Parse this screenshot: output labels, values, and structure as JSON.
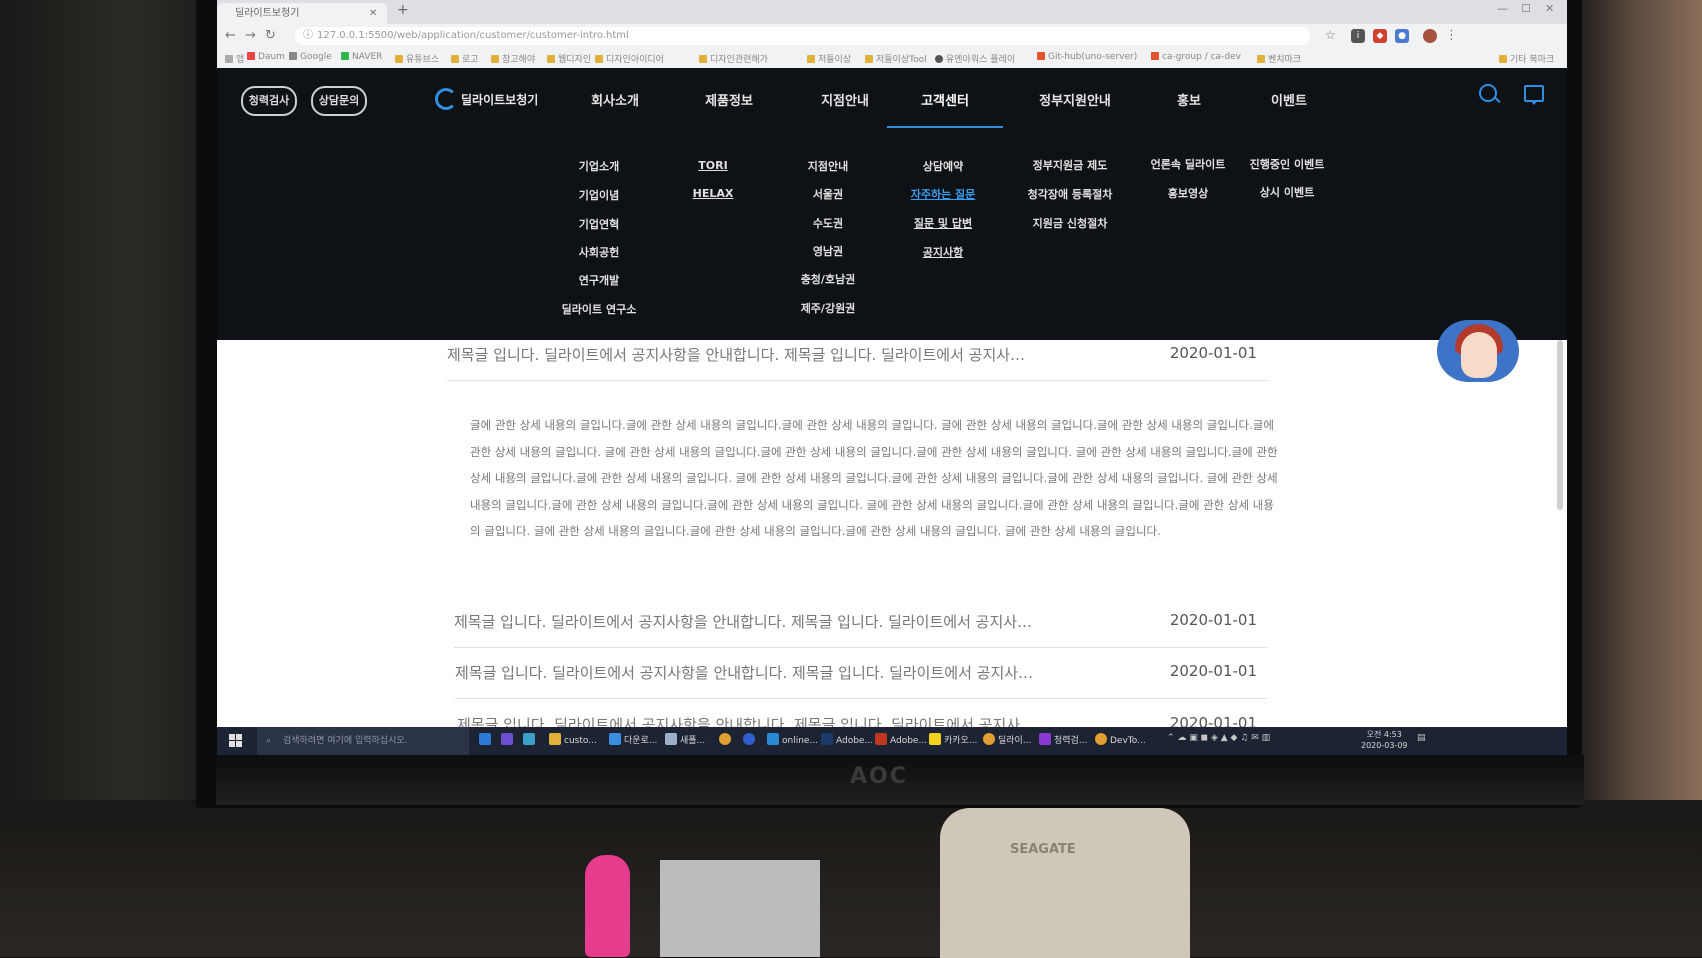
{
  "browser": {
    "tab_title": "딜라이트보청기",
    "url": "127.0.0.1:5500/web/application/customer/customer-intro.html",
    "bookmarks": [
      "앱",
      "Daum",
      "Google",
      "NAVER",
      "유튜브스",
      "로고",
      "참고해야",
      "웹디자인",
      "디자인아이디어",
      "디자인관련해가",
      "저들이상",
      "저들이상Tool",
      "유엔아워스 플레이",
      "Git-hub(uno-server)",
      "ca-group / ca-dev",
      "벤치마크"
    ],
    "other_bookmarks": "기타 북마크"
  },
  "site": {
    "buttons": [
      "청력검사",
      "상담문의"
    ],
    "logo_text": "딜라이트보청기",
    "menu": [
      "회사소개",
      "제품정보",
      "지점안내",
      "고객센터",
      "정부지원안내",
      "홍보",
      "이벤트"
    ],
    "active_menu": "고객센터",
    "submenu": {
      "company": [
        "기업소개",
        "기업이념",
        "기업연혁",
        "사회공헌",
        "연구개발",
        "딜라이트 연구소"
      ],
      "product": [
        "TORI",
        "HELAX"
      ],
      "branch": [
        "지점안내",
        "서울권",
        "수도권",
        "영남권",
        "충청/호남권",
        "제주/강원권"
      ],
      "support": [
        "상담예약",
        "자주하는 질문",
        "질문 및 답변",
        "공지사항"
      ],
      "gov": [
        "정부지원금 제도",
        "청각장애 등록절차",
        "지원금 신청절차"
      ],
      "pr": [
        "언론속 딜라이트",
        "홍보영상"
      ],
      "event": [
        "진행중인 이벤트",
        "상시 이벤트"
      ]
    }
  },
  "notice": {
    "rows": [
      {
        "title": "제목글 입니다. 딜라이트에서 공지사항을 안내합니다. 제목글 입니다. 딜라이트에서 공지사…",
        "date": "2020-01-01"
      },
      {
        "title": "제목글 입니다. 딜라이트에서 공지사항을 안내합니다. 제목글 입니다. 딜라이트에서 공지사…",
        "date": "2020-01-01"
      },
      {
        "title": "제목글 입니다. 딜라이트에서 공지사항을 안내합니다. 제목글 입니다. 딜라이트에서 공지사…",
        "date": "2020-01-01"
      },
      {
        "title": "제목글 입니다. 딜라이트에서 공지사항을 안내합니다. 제목글 입니다. 딜라이트에서 공지사…",
        "date": "2020-01-01"
      }
    ],
    "detail": "글에 관한 상세 내용의 글입니다.글에 관한 상세 내용의 글입니다.글에 관한 상세 내용의 글입니다. 글에 관한 상세 내용의 글입니다.글에 관한 상세 내용의 글입니다.글에 관한 상세 내용의 글입니다. 글에 관한 상세 내용의 글입니다.글에 관한 상세 내용의 글입니다.글에 관한 상세 내용의 글입니다. 글에 관한 상세 내용의 글입니다.글에 관한 상세 내용의 글입니다.글에 관한 상세 내용의 글입니다. 글에 관한 상세 내용의 글입니다.글에 관한 상세 내용의 글입니다.글에 관한 상세 내용의 글입니다. 글에 관한 상세 내용의 글입니다.글에 관한 상세 내용의 글입니다.글에 관한 상세 내용의 글입니다. 글에 관한 상세 내용의 글입니다.글에 관한 상세 내용의 글입니다.글에 관한 상세 내용의 글입니다. 글에 관한 상세 내용의 글입니다.글에 관한 상세 내용의 글입니다.글에 관한 상세 내용의 글입니다. 글에 관한 상세 내용의 글입니다."
  },
  "taskbar": {
    "search_placeholder": "검색하려면 여기에 입력하십시오.",
    "apps": [
      "custo...",
      "다운로...",
      "새폴...",
      "online...",
      "Adobe...",
      "Adobe...",
      "카카오...",
      "딜라이...",
      "청력검...",
      "DevTo..."
    ],
    "time": "오전 4:53",
    "date": "2020-03-09"
  },
  "monitor_brand": "AOC",
  "drive_label": "SEAGATE",
  "colors": {
    "accent": "#2f8fe0",
    "nav_bg": "#0e1116"
  }
}
